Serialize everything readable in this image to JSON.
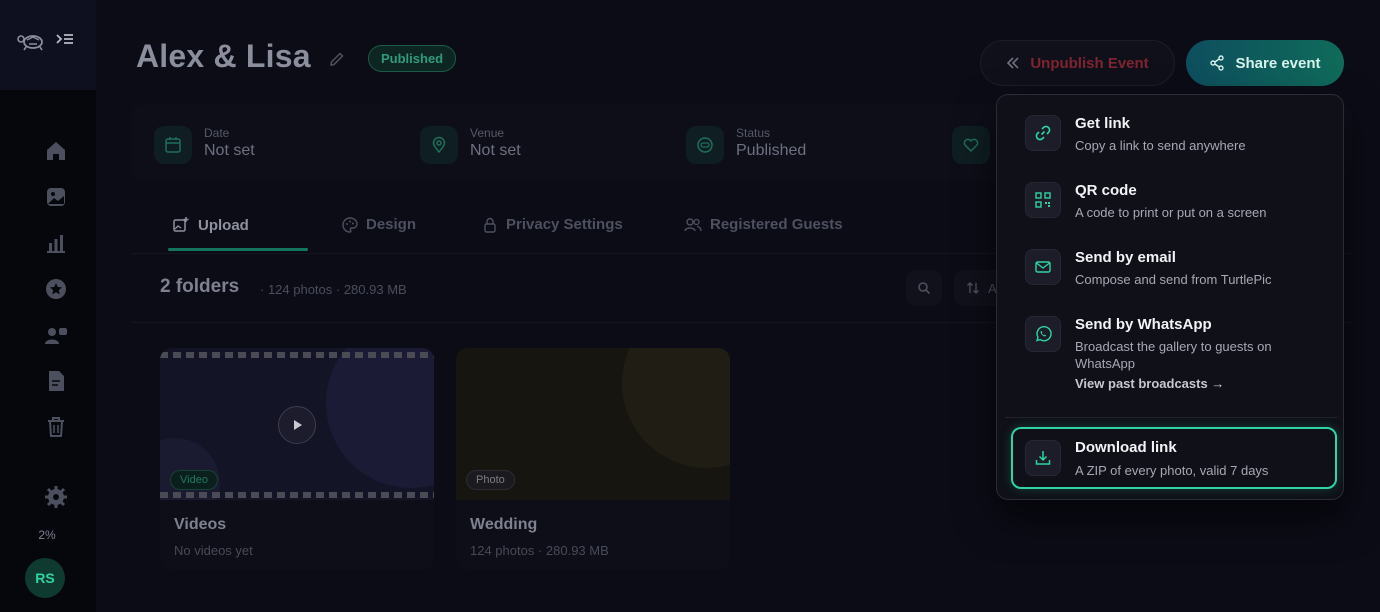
{
  "event": {
    "title": "Alex & Lisa",
    "status_badge": "Published"
  },
  "header": {
    "unpublish_label": "Unpublish Event",
    "share_label": "Share event"
  },
  "info": {
    "date_label": "Date",
    "date_value": "Not set",
    "venue_label": "Venue",
    "venue_value": "Not set",
    "status_label": "Status",
    "status_value": "Published"
  },
  "tabs": [
    {
      "label": "Upload"
    },
    {
      "label": "Design"
    },
    {
      "label": "Privacy Settings"
    },
    {
      "label": "Registered Guests"
    }
  ],
  "folders": {
    "title": "2 folders",
    "meta": "· 124 photos · 280.93 MB",
    "sort_partial": "A",
    "items": [
      {
        "badge": "Video",
        "name": "Videos",
        "sub": "No videos yet"
      },
      {
        "badge": "Photo",
        "name": "Wedding",
        "sub": "124 photos · 280.93 MB"
      }
    ]
  },
  "sidebar": {
    "usage": "2%",
    "avatar_initials": "RS"
  },
  "share_menu": {
    "items": [
      {
        "title": "Get link",
        "desc": "Copy a link to send anywhere"
      },
      {
        "title": "QR code",
        "desc": "A code to print or put on a screen"
      },
      {
        "title": "Send by email",
        "desc": "Compose and send from TurtlePic"
      },
      {
        "title": "Send by WhatsApp",
        "desc": "Broadcast the gallery to guests on WhatsApp",
        "link": "View past broadcasts →"
      }
    ],
    "download": {
      "title": "Download link",
      "desc": "A ZIP of every photo, valid 7 days"
    }
  },
  "colors": {
    "accent": "#2fd4a0",
    "danger": "#7f2430",
    "background": "#0b0c16"
  }
}
